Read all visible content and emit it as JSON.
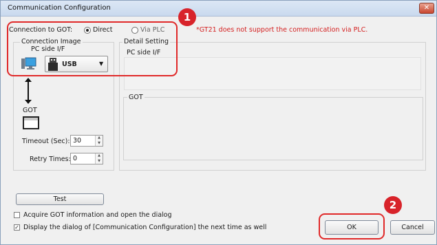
{
  "window": {
    "title": "Communication Configuration",
    "close": "✕"
  },
  "connection": {
    "label": "Connection to GOT:",
    "direct": "Direct",
    "via_plc": "Via PLC",
    "note": "*GT21 does not support the communication via PLC."
  },
  "image_group": {
    "label": "Connection Image",
    "pc_side": "PC side I/F",
    "usb": "USB",
    "got": "GOT"
  },
  "timeout": {
    "label": "Timeout (Sec):",
    "value": "30"
  },
  "retry": {
    "label": "Retry Times:",
    "value": "0"
  },
  "detail": {
    "label": "Detail Setting",
    "pc_side": "PC side I/F",
    "got": "GOT"
  },
  "buttons": {
    "test": "Test",
    "ok": "OK",
    "cancel": "Cancel"
  },
  "checkboxes": {
    "acquire": "Acquire GOT information and open the dialog",
    "display": "Display the dialog of [Communication Configuration] the next time as well"
  },
  "markers": {
    "one": "1",
    "two": "2"
  }
}
